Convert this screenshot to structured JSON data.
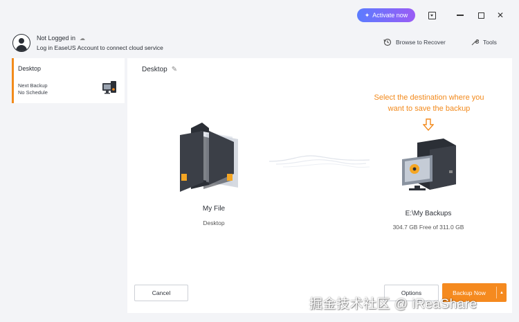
{
  "titlebar": {
    "activate_label": "Activate now"
  },
  "account": {
    "title": "Not Logged in",
    "subtitle": "Log in EaseUS Account to connect cloud service"
  },
  "top_actions": {
    "browse_label": "Browse to Recover",
    "tools_label": "Tools"
  },
  "sidebar": {
    "items": [
      {
        "title": "Desktop",
        "next_backup": "Next Backup",
        "schedule": "No Schedule"
      }
    ]
  },
  "main": {
    "title": "Desktop",
    "hint_line1": "Select the destination where you",
    "hint_line2": "want to save the backup",
    "source": {
      "name": "My File",
      "sub": "Desktop"
    },
    "destination": {
      "name": "E:\\My Backups",
      "sub": "304.7 GB Free of 311.0 GB"
    }
  },
  "buttons": {
    "cancel": "Cancel",
    "options": "Options",
    "backup_now": "Backup Now"
  },
  "watermark": "掘金技术社区 @ iReaShare",
  "colors": {
    "accent": "#f58a1f",
    "activate_start": "#5b7cff",
    "activate_end": "#9a5cf5",
    "hint": "#f2891b"
  },
  "icons": [
    "spark-icon",
    "menu-dropdown-icon",
    "minimize-icon",
    "maximize-icon",
    "close-icon",
    "avatar-icon",
    "cloud-icon",
    "browse-recover-icon",
    "tools-icon",
    "computer-icon",
    "edit-icon",
    "folder-icon",
    "down-arrow-icon",
    "pc-destination-icon",
    "dropdown-caret-icon"
  ]
}
